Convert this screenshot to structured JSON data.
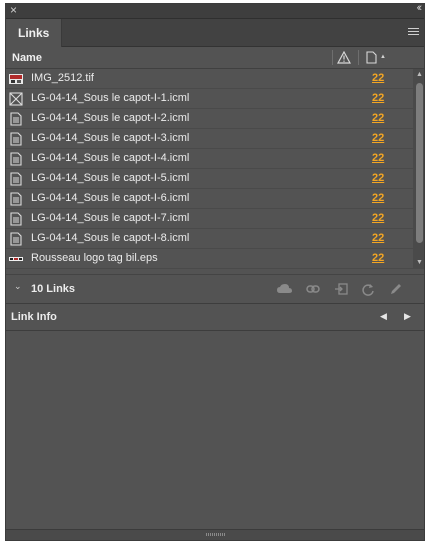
{
  "panel": {
    "close_glyph": "×",
    "collapse_glyph": "‹‹",
    "tab_label": "Links",
    "menu_icon": "panel-menu-icon"
  },
  "columns": {
    "name": "Name",
    "status_icon": "warning-icon",
    "page_icon": "page-icon"
  },
  "links": [
    {
      "name": "IMG_2512.tif",
      "page": "22",
      "icon": "image-thumbnail-icon"
    },
    {
      "name": "LG-04-14_Sous le capot-I-1.icml",
      "page": "22",
      "icon": "missing-image-icon"
    },
    {
      "name": "LG-04-14_Sous le capot-I-2.icml",
      "page": "22",
      "icon": "document-icon"
    },
    {
      "name": "LG-04-14_Sous le capot-I-3.icml",
      "page": "22",
      "icon": "document-icon"
    },
    {
      "name": "LG-04-14_Sous le capot-I-4.icml",
      "page": "22",
      "icon": "document-icon"
    },
    {
      "name": "LG-04-14_Sous le capot-I-5.icml",
      "page": "22",
      "icon": "document-icon"
    },
    {
      "name": "LG-04-14_Sous le capot-I-6.icml",
      "page": "22",
      "icon": "document-icon"
    },
    {
      "name": "LG-04-14_Sous le capot-I-7.icml",
      "page": "22",
      "icon": "document-icon"
    },
    {
      "name": "LG-04-14_Sous le capot-I-8.icml",
      "page": "22",
      "icon": "document-icon"
    },
    {
      "name": "Rousseau logo tag bil.eps",
      "page": "22",
      "icon": "logo-thumbnail-icon"
    }
  ],
  "status": {
    "count_label": "10 Links",
    "tools": [
      "cloud-link-icon",
      "relink-icon",
      "go-to-link-icon",
      "update-link-icon",
      "edit-original-icon"
    ]
  },
  "link_info": {
    "title": "Link Info",
    "prev_glyph": "◀",
    "next_glyph": "▶"
  },
  "colors": {
    "panel_bg": "#535353",
    "page_link": "#f4a623"
  }
}
